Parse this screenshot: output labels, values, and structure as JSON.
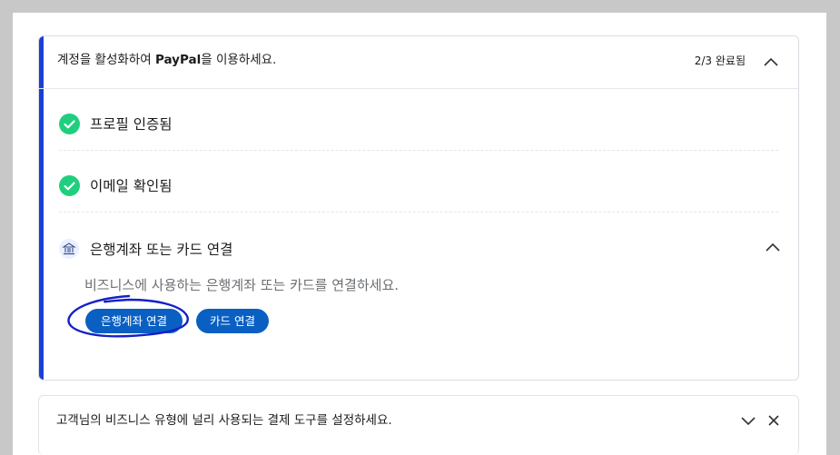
{
  "activation": {
    "title_pre": "계정을 활성화하여 ",
    "title_brand": "PayPal",
    "title_post": "을 이용하세요.",
    "progress": "2/3 완료됨",
    "collapse_icon": "chevron-up-icon"
  },
  "steps": [
    {
      "label": "프로필 인증됨",
      "status": "complete"
    },
    {
      "label": "이메일 확인됨",
      "status": "complete"
    }
  ],
  "bank_step": {
    "label": "은행계좌 또는 카드 연결",
    "description": "비즈니스에 사용하는 은행계좌 또는 카드를 연결하세요.",
    "link_bank_button": "은행계좌 연결",
    "link_card_button": "카드 연결",
    "icon": "bank-icon"
  },
  "payment_tools": {
    "title": "고객님의 비즈니스 유형에 널리 사용되는 결제 도구를 설정하세요.",
    "expand_icon": "chevron-down-icon",
    "close_icon": "close-icon"
  },
  "colors": {
    "accent_bar": "#1b3fd6",
    "check_green": "#1fcf7e",
    "button_blue": "#0a60c2",
    "annotation_ink": "#1420c8"
  }
}
